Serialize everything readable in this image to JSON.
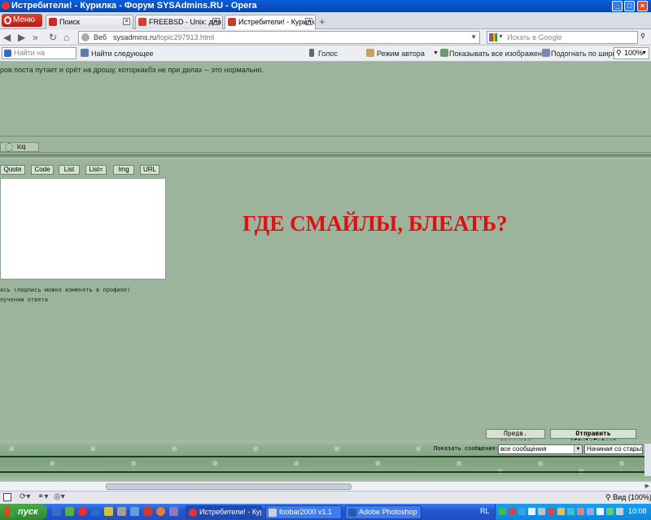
{
  "window": {
    "title": "Истребители! - Курилка - Форум SYSAdmins.RU - Opera"
  },
  "tabbar": {
    "menu_label": "Меню",
    "tabs": [
      {
        "label": "Поиск",
        "favicon_color": "#cc2a20"
      },
      {
        "label": "FREEBSD - Unix: для нов…",
        "favicon_color": "#d04030"
      },
      {
        "label": "Истребители! - Курилк…",
        "favicon_color": "#c83a2a"
      }
    ]
  },
  "addressbar": {
    "web_label": "Веб",
    "url_domain": "sysadmins.ru",
    "url_path": "/topic297913.html",
    "search_placeholder": "Искать в Google"
  },
  "findbar": {
    "find_placeholder": "Найти на странице",
    "find_next": "Найти следующее",
    "voice": "Голос",
    "author_mode": "Режим автора",
    "show_images": "Показывать все изображения",
    "fit_width": "Подогнать по ширине",
    "zoom": "100%"
  },
  "page": {
    "post_text": "ров поста путает и орёт на дрошу, которкакбэ не при делах -- это нормально.",
    "icq_label": "icq",
    "toolbar": [
      "Quote",
      "Code",
      "List",
      "List=",
      "Img",
      "URL"
    ],
    "signature_line": "ись (подпись можно изменять в профиле)",
    "notify_line": "лучении ответа",
    "shout": "ГДЕ СМАЙЛЫ, БЛЕАТЬ?",
    "preview_button": "Предв. просмотр",
    "send_button": "Отправить (Ctrl+Enter)",
    "show_messages_label": "Показать сообщения:",
    "messages_select": "все сообщения",
    "order_select": "Начиная со старых"
  },
  "statusbar": {
    "zoom": "Вид (100%)"
  },
  "taskbar": {
    "start": "пуск",
    "tasks": [
      {
        "label": "Истребители! - Кур...",
        "icon_color": "#e8322a"
      },
      {
        "label": "foobar2000 v1.1",
        "icon_color": "#d0d0d0"
      },
      {
        "label": "Adobe Photoshop",
        "icon_color": "#2a5aa8"
      }
    ],
    "lang": "RL",
    "clock": "10:08"
  }
}
